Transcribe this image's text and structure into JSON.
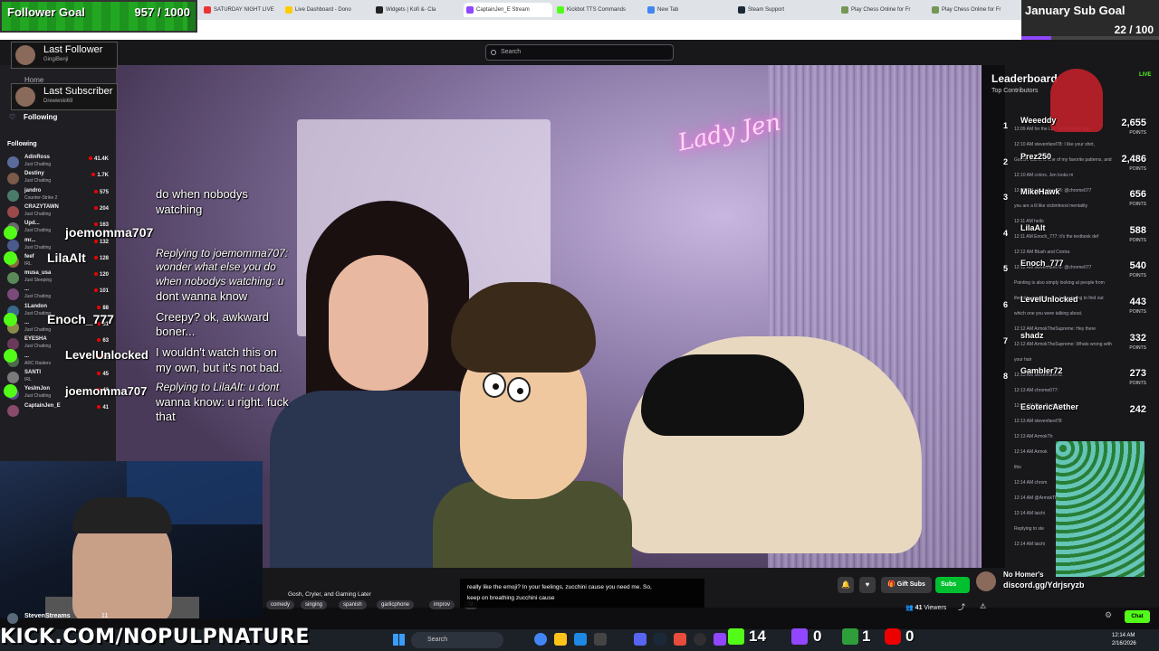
{
  "browser_tabs": [
    {
      "label": "SATURDAY NIGHT LIVE",
      "color": "#e33"
    },
    {
      "label": "Live Dashboard - Dono",
      "color": "#fc0"
    },
    {
      "label": "Widgets | Kofi &- Cla",
      "color": "#222"
    },
    {
      "label": "CaptainJen_E Stream",
      "color": "#9146ff",
      "active": true
    },
    {
      "label": "Kickbot TTS Commands",
      "color": "#53fc18"
    },
    {
      "label": "New Tab",
      "color": "#4285f4"
    },
    {
      "label": "Steam Support",
      "color": "#1b2838"
    },
    {
      "label": "Play Chess Online for Fr",
      "color": "#769656"
    },
    {
      "label": "Play Chess Online for Fr",
      "color": "#769656"
    }
  ],
  "search": {
    "placeholder": "Search"
  },
  "follower_goal": {
    "label": "Follower Goal",
    "value": "957 / 1000",
    "progress": 0.957
  },
  "last_follower": {
    "title": "Last Follower",
    "name": "GingiBenji"
  },
  "last_subscriber": {
    "title": "Last Subscriber",
    "name": "Drewwski69"
  },
  "sub_goal": {
    "label": "January Sub Goal",
    "value": "22 / 100",
    "progress": 0.22
  },
  "sidebar": {
    "home": "Home",
    "following_nav": "Following",
    "following_header": "Following",
    "channels": [
      {
        "name": "AdinRoss",
        "game": "Just Chatting",
        "viewers": "41.4K"
      },
      {
        "name": "Destiny",
        "game": "Just Chatting",
        "viewers": "1.7K"
      },
      {
        "name": "jandro",
        "game": "Counter-Strike 2",
        "viewers": "575"
      },
      {
        "name": "CRAZYTAWN",
        "game": "Just Chatting",
        "viewers": "204"
      },
      {
        "name": "Upd...",
        "game": "Just Chatting",
        "viewers": "163"
      },
      {
        "name": "mr...",
        "game": "Just Chatting",
        "viewers": "132"
      },
      {
        "name": "feef",
        "game": "IRL",
        "viewers": "128"
      },
      {
        "name": "musa_usa",
        "game": "Just Sleeping",
        "viewers": "120"
      },
      {
        "name": "...",
        "game": "Just Chatting",
        "viewers": "101"
      },
      {
        "name": "1Landon",
        "game": "Just Chatting",
        "viewers": "88"
      },
      {
        "name": "...",
        "game": "Just Chatting",
        "viewers": "81"
      },
      {
        "name": "EYESHA",
        "game": "Just Chatting",
        "viewers": "63"
      },
      {
        "name": "...",
        "game": "ARC Raiders",
        "viewers": "62"
      },
      {
        "name": "SANTI",
        "game": "IRL",
        "viewers": "45"
      },
      {
        "name": "YesImJon",
        "game": "Just Chatting",
        "viewers": "43"
      },
      {
        "name": "CaptainJen_E",
        "game": "",
        "viewers": "41"
      }
    ],
    "bottom_user": "StevenStreams",
    "bottom_user_viewers": "11"
  },
  "overlay_chat": {
    "line1": "do when nobodys",
    "line2": "watching",
    "user1": "joemomma707",
    "reply1": "Replying to joemomma707:",
    "reply1b": "wonder what else you do",
    "reply1c": "when nobodys watching:  u",
    "reply1d": "dont wanna know",
    "user2": "LilaAlt",
    "msg2a": "Creepy? ok, awkward",
    "msg2b": "boner...",
    "user3": "Enoch_777",
    "msg3a": "I wouldn't watch this on",
    "msg3b": "my own, but it's not bad.",
    "user4": "LevelUnlocked",
    "user5": "joemomma707",
    "reply5a": "Replying to LilaAlt: u dont",
    "reply5b": "wanna know:  u right. fuck",
    "reply5c": "that"
  },
  "leaderboard": {
    "title": "Leaderboard",
    "subtitle": "Top Contributors",
    "points_label": "POINTS",
    "entries": [
      {
        "rank": "1",
        "name": "Weeeddy",
        "points": "2,655"
      },
      {
        "rank": "2",
        "name": "Prez250",
        "points": "2,486"
      },
      {
        "rank": "3",
        "name": "MikeHawk",
        "points": "656"
      },
      {
        "rank": "4",
        "name": "LilaAlt",
        "points": "588"
      },
      {
        "rank": "5",
        "name": "Enoch_777",
        "points": "540"
      },
      {
        "rank": "6",
        "name": "LevelUnlocked",
        "points": "443"
      },
      {
        "rank": "7",
        "name": "shadz",
        "points": "332"
      },
      {
        "rank": "8",
        "name": "Gambler72",
        "points": "273"
      },
      {
        "rank": "",
        "name": "EsotericAether",
        "points": "242"
      }
    ]
  },
  "chat_panel": {
    "live_label": "LIVE",
    "lines": [
      "12:09 AM  for the Lul .. in midnight sun",
      "12:10 AM  stevenfarel78: I like your shirt,",
      "Gooch. Camo is one of my favorite patterns, and",
      "12:10 AM  colors. Jen looks m",
      "12:10 AM  stevenfarel78: @chrome077",
      "you are a lil like victimhood mentality",
      "12:11 AM  hello",
      "12:11 AM  Enoch_777: it's the textbook def",
      "12:12 AM  Blush and Contra",
      "12:12 AM  stevenfarel78: @chrome077",
      "Pointing is also simply looking at people from",
      "the side view, too. So, I was trying to find out",
      "which one you were talking about.",
      "12:12 AM  ArmokTheSupreme: Hey there",
      "12:12 AM  ArmokTheSupreme: Whats wrong with",
      "your hair",
      "12:13 AM  stevenfarel78:",
      "12:13 AM  chrome077:",
      "12:13 AM  The_Luminary:",
      "12:13 AM  stevenfarel78",
      "12:13 AM  ArmokTh",
      "12:14 AM  Armok",
      "this",
      "12:14 AM  chrom",
      "12:14 AM  @ArmokTheS",
      "12:14 AM  laichi",
      "Replying to ste",
      "12:14 AM  laichi"
    ]
  },
  "stream_info": {
    "title": "Gosh, Cryler, and Gaming Later",
    "tags": [
      "comedy",
      "singing",
      "spanish",
      "garlicphone",
      "improv",
      "St"
    ],
    "viewers": "41",
    "viewers_label": "Viewers",
    "gift_subs": "Gift Subs",
    "subscribe": "Subs"
  },
  "caption": {
    "text1": "really like the emoji? In your feelings, zucchini cause you need me. So,",
    "text2": "keep on breathing zucchini cause"
  },
  "kick_url": "KICK.COM/NOPULPNATURE",
  "socials": {
    "kick_followers": "14",
    "twitch_count": "0",
    "kick_subs": "1",
    "youtube_count": "0"
  },
  "promo": {
    "no_homers": "No Homer's",
    "discord": "discord.gg/Ydrjsryzb"
  },
  "taskbar": {
    "search": "Search",
    "time": "12:14 AM",
    "date": "2/16/2026"
  },
  "neon_sign": "Lady Jen"
}
